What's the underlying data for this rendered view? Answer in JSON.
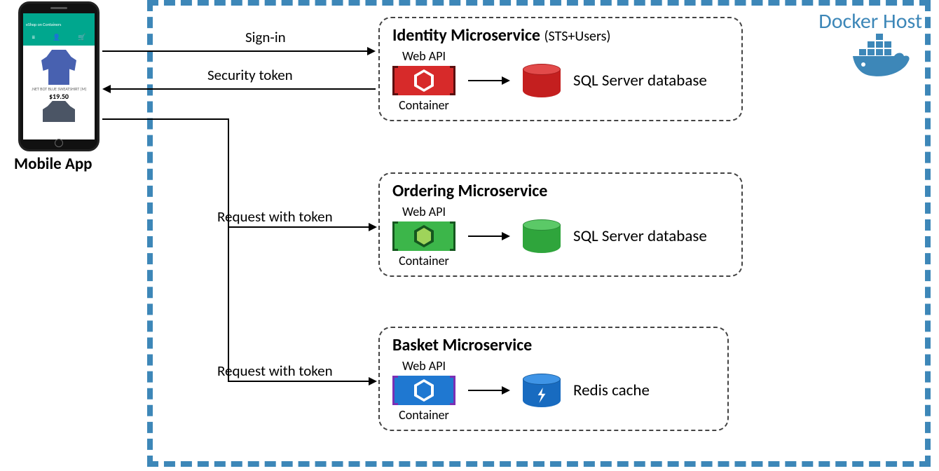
{
  "host": {
    "label": "Docker Host"
  },
  "client": {
    "label": "Mobile App",
    "screen_title": "eShop on Containers",
    "product": ".NET BOT BLUE SWEATSHIRT (M)",
    "price": "$19.50"
  },
  "arrows": {
    "signin": "Sign-in",
    "token": "Security token",
    "req1": "Request with token",
    "req2": "Request with token"
  },
  "services": {
    "identity": {
      "title": "Identity Microservice",
      "subtitle": "(STS+Users)",
      "api_label": "Web API",
      "container_label": "Container",
      "db_label": "SQL Server database",
      "color": "#d72a2a",
      "color_dark": "#a81c1c"
    },
    "ordering": {
      "title": "Ordering Microservice",
      "api_label": "Web API",
      "container_label": "Container",
      "db_label": "SQL Server database",
      "color": "#3cb64a",
      "hex_fill": "#9fd45a",
      "color_dark": "#2a8c37"
    },
    "basket": {
      "title": "Basket Microservice",
      "api_label": "Web API",
      "container_label": "Container",
      "db_label": "Redis cache",
      "color": "#1f78d1",
      "color_dark": "#145a9e",
      "bracket_color": "#7b2fb5"
    }
  }
}
